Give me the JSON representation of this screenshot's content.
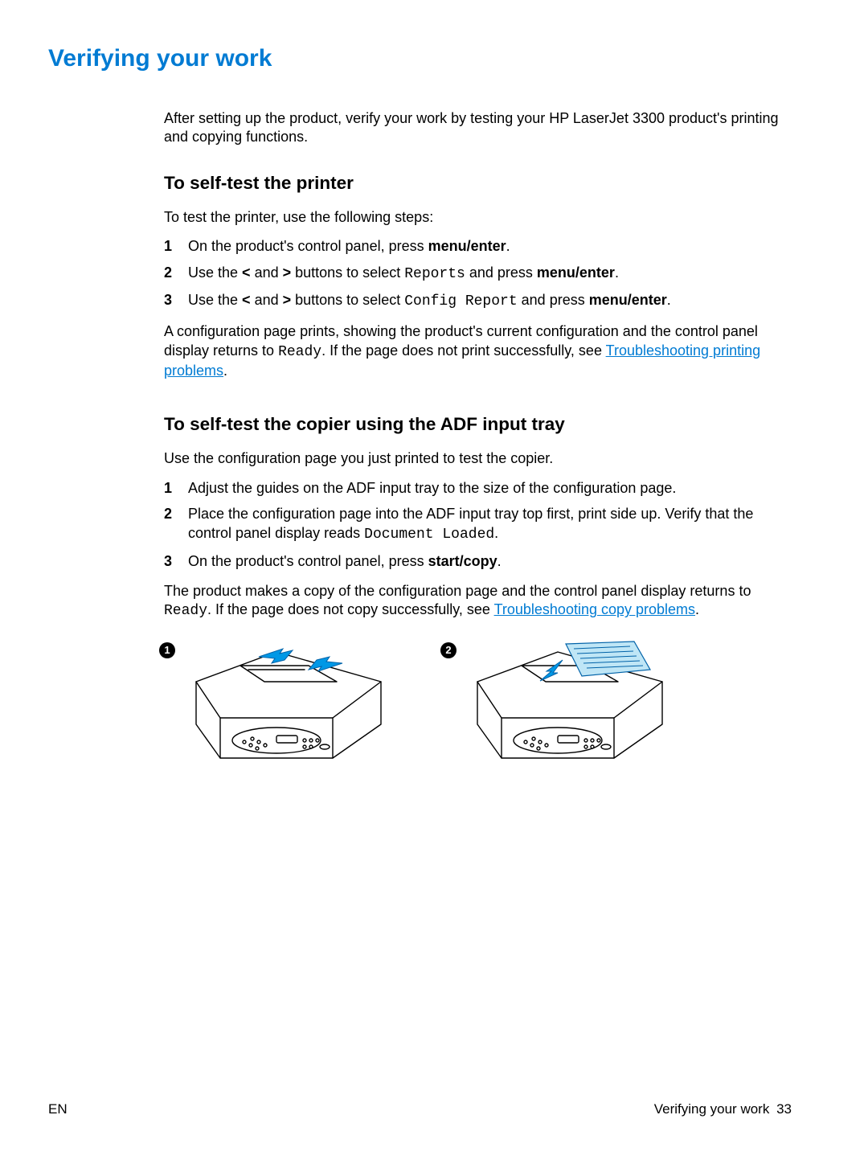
{
  "title": "Verifying your work",
  "intro": "After setting up the product, verify your work by testing your HP LaserJet 3300 product's printing and copying functions.",
  "section1": {
    "heading": "To self-test the printer",
    "lead": "To test the printer, use the following steps:",
    "steps": {
      "s1_pre": "On the product's control panel, press ",
      "s1_bold": "menu/enter",
      "s1_post": ".",
      "s2_pre": "Use the ",
      "s2_bold1": "<",
      "s2_mid1": " and ",
      "s2_bold2": ">",
      "s2_mid2": " buttons to select ",
      "s2_mono": "Reports",
      "s2_mid3": " and press ",
      "s2_bold3": "menu/enter",
      "s2_post": ".",
      "s3_pre": "Use the ",
      "s3_bold1": "<",
      "s3_mid1": " and ",
      "s3_bold2": ">",
      "s3_mid2": " buttons to select ",
      "s3_mono": "Config Report",
      "s3_mid3": " and press ",
      "s3_bold3": "menu/enter",
      "s3_post": "."
    },
    "result_pre": "A configuration page prints, showing the product's current configuration and the control panel display returns to ",
    "result_mono": "Ready",
    "result_mid": ". If the page does not print successfully, see ",
    "result_link": "Troubleshooting printing problems",
    "result_post": "."
  },
  "section2": {
    "heading": "To self-test the copier using the ADF input tray",
    "lead": "Use the configuration page you just printed to test the copier.",
    "steps": {
      "s1": "Adjust the guides on the ADF input tray to the size of the configuration page.",
      "s2_pre": "Place the configuration page into the ADF input tray top first, print side up. Verify that the control panel display reads ",
      "s2_mono": "Document Loaded",
      "s2_post": ".",
      "s3_pre": "On the product's control panel, press ",
      "s3_bold": "start/copy",
      "s3_post": "."
    },
    "result_pre": "The product makes a copy of the configuration page and the control panel display returns to ",
    "result_mono": "Ready",
    "result_mid": ". If the page does not copy successfully, see ",
    "result_link": "Troubleshooting copy problems",
    "result_post": "."
  },
  "figures": {
    "badge1": "1",
    "badge2": "2"
  },
  "footer": {
    "left": "EN",
    "right_text": "Verifying your work",
    "right_page": "33"
  }
}
